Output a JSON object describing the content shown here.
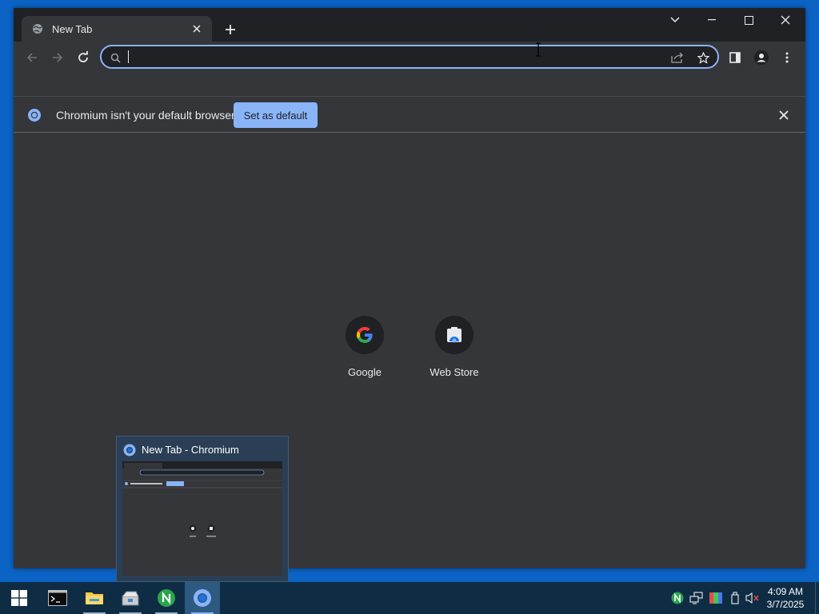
{
  "browser": {
    "tab": {
      "title": "New Tab",
      "favicon": "globe-icon"
    },
    "new_tab_icon": "plus-icon",
    "window_controls": [
      "tab-search-icon",
      "minimize-icon",
      "maximize-icon",
      "close-icon"
    ],
    "omnibox": {
      "value": "",
      "placeholder": ""
    },
    "toolbar_icons": [
      "back-icon",
      "forward-icon",
      "reload-icon",
      "share-icon",
      "bookmark-star-icon",
      "side-panel-icon",
      "profile-icon",
      "menu-icon"
    ],
    "accent": "#8ab4f8"
  },
  "infobar": {
    "message": "Chromium isn't your default browser",
    "button_label": "Set as default"
  },
  "shortcuts": [
    {
      "label": "Google",
      "icon": "google-g-icon"
    },
    {
      "label": "Web Store",
      "icon": "web-store-icon"
    }
  ],
  "taskbar_preview": {
    "title": "New Tab - Chromium"
  },
  "taskbar": {
    "apps": [
      "windows-start-icon",
      "terminal-icon",
      "file-explorer-icon",
      "package-manager-icon",
      "n-app-icon",
      "chromium-icon"
    ],
    "tray_icons": [
      "n-tray-icon",
      "network-icon",
      "color-picker-icon",
      "usb-icon",
      "volume-muted-icon"
    ],
    "clock": {
      "time": "4:09 AM",
      "date": "3/7/2025"
    }
  }
}
